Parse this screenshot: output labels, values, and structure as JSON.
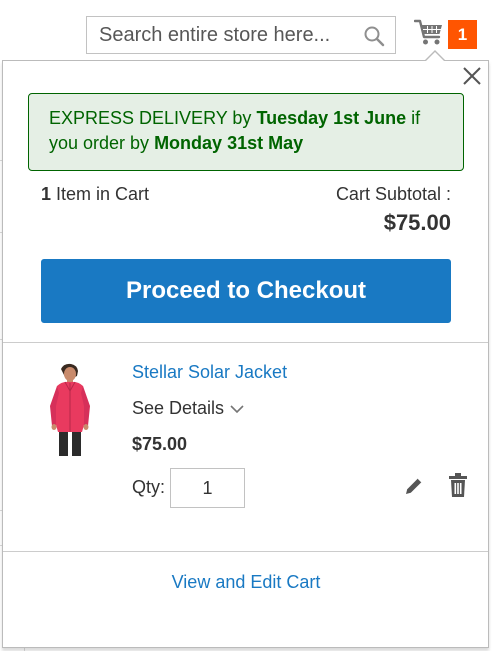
{
  "header": {
    "search": {
      "placeholder": "Search entire store here...",
      "value": ""
    },
    "cart_counter": "1"
  },
  "minicart": {
    "delivery": {
      "prefix": "EXPRESS DELIVERY by ",
      "delivery_date": "Tuesday 1st June",
      "middle": " if you order by ",
      "order_date": "Monday 31st May"
    },
    "items_count": "1",
    "items_label": " Item in Cart",
    "subtotal_label": "Cart Subtotal :",
    "subtotal_price": "$75.00",
    "checkout_label": "Proceed to Checkout",
    "item": {
      "name": "Stellar Solar Jacket",
      "details_label": "See Details",
      "price": "$75.00",
      "qty_label": "Qty:",
      "qty_value": "1"
    },
    "view_cart_label": "View and Edit Cart"
  },
  "colors": {
    "accent_blue": "#1979c3",
    "counter_orange": "#ff5501",
    "notice_green": "#006400",
    "notice_bg": "#e5efe5"
  },
  "icons": {
    "search": "search-icon",
    "cart": "cart-icon",
    "close": "close-icon",
    "chevron": "chevron-down-icon",
    "edit": "pencil-icon",
    "delete": "trash-icon"
  }
}
